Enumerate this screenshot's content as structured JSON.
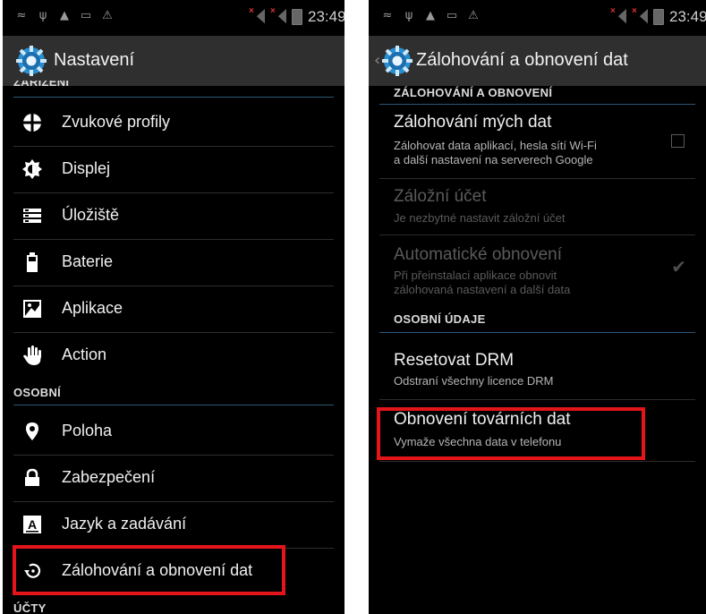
{
  "left": {
    "status_time": "23:49",
    "title": "Nastavení",
    "section_device_partial": "ZAŘÍZENÍ",
    "device_items": [
      {
        "label": "Zvukové profily",
        "icon": "sound-profile-icon"
      },
      {
        "label": "Displej",
        "icon": "display-icon"
      },
      {
        "label": "Úložiště",
        "icon": "storage-icon"
      },
      {
        "label": "Baterie",
        "icon": "battery-icon"
      },
      {
        "label": "Aplikace",
        "icon": "apps-icon"
      },
      {
        "label": "Action",
        "icon": "hand-icon"
      }
    ],
    "section_personal": "OSOBNÍ",
    "personal_items": [
      {
        "label": "Poloha",
        "icon": "location-pin-icon"
      },
      {
        "label": "Zabezpečení",
        "icon": "lock-icon"
      },
      {
        "label": "Jazyk a zadávání",
        "icon": "keyboard-a-icon"
      },
      {
        "label": "Zálohování a obnovení dat",
        "icon": "backup-restore-icon"
      }
    ],
    "section_accounts": "ÚČTY"
  },
  "right": {
    "status_time": "23:49",
    "title": "Zálohování a obnovení dat",
    "section_backup": "ZÁLOHOVÁNÍ A OBNOVENÍ",
    "backup_my_data": {
      "title": "Zálohování mých dat",
      "sub1": "Zálohovat data aplikací, hesla sítí Wi-Fi",
      "sub2": "a další nastavení na serverech Google",
      "checked": false
    },
    "backup_account": {
      "title": "Záložní účet",
      "sub1": "Je nezbytné nastavit záložní účet"
    },
    "auto_restore": {
      "title": "Automatické obnovení",
      "sub1": "Při přeinstalaci aplikace obnovit",
      "sub2": "zálohovaná nastavení a další data",
      "checked": true
    },
    "section_personal_data": "OSOBNÍ ÚDAJE",
    "reset_drm": {
      "title": "Resetovat DRM",
      "sub1": "Odstraní všechny licence DRM"
    },
    "factory_reset": {
      "title": "Obnovení továrních dat",
      "sub1": "Vymaže všechna data v telefonu"
    }
  },
  "colors": {
    "highlight": "#e3141a",
    "accent": "#3b7fa6",
    "actionbar": "#2f2f2f"
  }
}
